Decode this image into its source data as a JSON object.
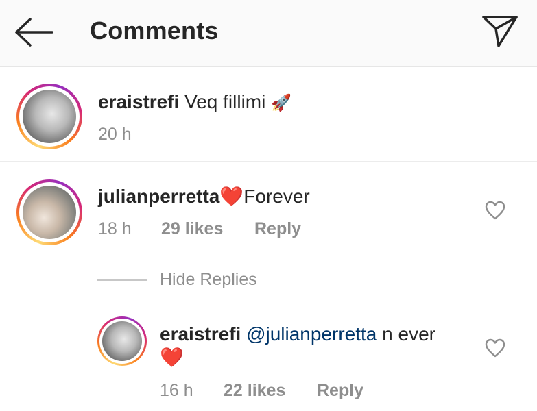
{
  "header": {
    "title": "Comments",
    "back_icon": "arrow-left-icon",
    "send_icon": "paper-plane-icon"
  },
  "caption": {
    "username": "eraistrefi",
    "text": "Veq fillimi",
    "emoji": "🚀",
    "time": "20 h"
  },
  "comments": [
    {
      "username": "julianperretta",
      "emoji": "❤️",
      "text": "Forever",
      "time": "18 h",
      "likes": "29 likes",
      "reply_label": "Reply",
      "hide_replies_label": "Hide Replies",
      "replies": [
        {
          "username": "eraistrefi",
          "mention": "@julianperretta",
          "text": "n ever",
          "emoji": "❤️",
          "time": "16 h",
          "likes": "22 likes",
          "reply_label": "Reply"
        }
      ]
    }
  ],
  "colors": {
    "mention": "#003569",
    "meta_text": "#8e8e8e",
    "heart": "#e0245e"
  }
}
